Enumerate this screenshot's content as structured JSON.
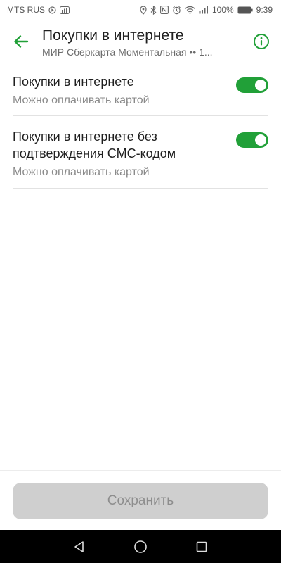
{
  "status_bar": {
    "carrier": "MTS RUS",
    "battery": "100%",
    "time": "9:39",
    "left_icons": [
      "play-circle-icon",
      "cellular-usage-icon"
    ],
    "right_icons": [
      "location-icon",
      "bluetooth-icon",
      "nfc-icon",
      "alarm-icon",
      "wifi-icon",
      "signal-icon",
      "battery-icon"
    ]
  },
  "header": {
    "back_icon": "arrow-left-icon",
    "title": "Покупки в интернете",
    "subtitle": "МИР Сберкарта Моментальная •• 1...",
    "info_icon": "info-icon",
    "accent": "#21a038"
  },
  "settings": [
    {
      "title": "Покупки в интернете",
      "description": "Можно оплачивать картой",
      "enabled": true
    },
    {
      "title": "Покупки в интернете без подтверждения СМС-кодом",
      "description": "Можно оплачивать картой",
      "enabled": true
    }
  ],
  "footer": {
    "save_label": "Сохранить",
    "save_enabled": false
  },
  "nav": {
    "icons": [
      "back-triangle-icon",
      "home-circle-icon",
      "recents-square-icon"
    ]
  }
}
